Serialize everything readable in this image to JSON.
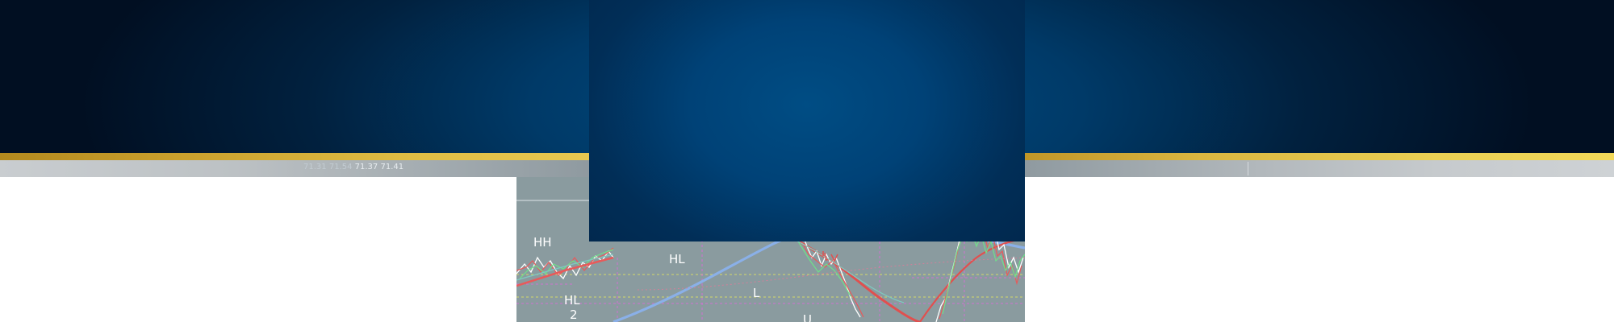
{
  "ticker": {
    "values": [
      "71.31",
      "71.54",
      "71.37",
      "71.41"
    ]
  },
  "chart": {
    "labels": {
      "hh": "HH",
      "hl_top": "HL",
      "hl_left": "HL",
      "l": "L",
      "two": "2",
      "u": "U"
    }
  },
  "colors": {
    "header_dark": "#010f22",
    "header_blue": "#004d84",
    "gold_band": "#e8c850",
    "chart_bg": "#8a9b9f",
    "ma_red": "#e0504f",
    "ma_blue": "#8ab0e8"
  }
}
